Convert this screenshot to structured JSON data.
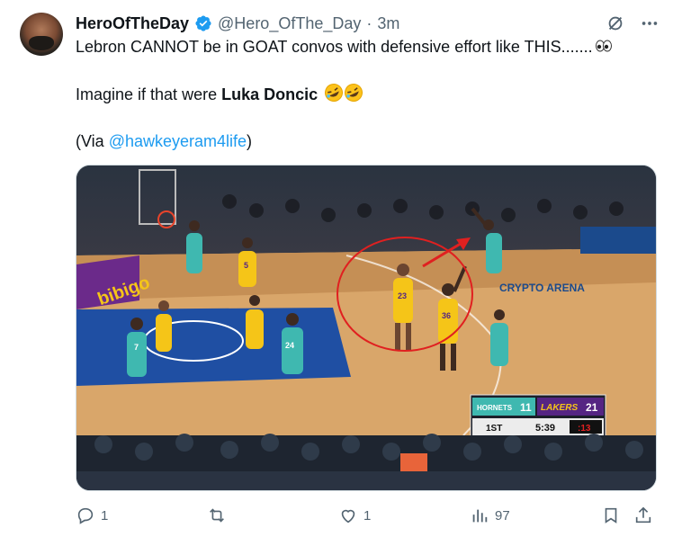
{
  "author": {
    "display_name": "HeroOfTheDay",
    "handle": "@Hero_OfThe_Day",
    "separator": "·",
    "time": "3m"
  },
  "tweet": {
    "line1": "Lebron CANNOT be in GOAT convos with defensive effort like THIS.......",
    "line2_prefix": "Imagine if that were ",
    "line2_bold": "Luka Doncic",
    "line3_prefix": "(Via ",
    "line3_mention": "@hawkeyeram4life",
    "line3_suffix": ")"
  },
  "media_texts": {
    "scoreboard_home": "HORNETS",
    "scoreboard_home_score": "11",
    "scoreboard_away": "LAKERS",
    "scoreboard_away_score": "21",
    "quarter": "1ST",
    "clock": "5:39",
    "shot_clock": ":13",
    "jersey_23": "23",
    "jersey_36": "36",
    "jersey_5": "5",
    "jersey_7": "7",
    "jersey_24": "24",
    "arena": "CRYPTO ARENA",
    "sponsor": "bibigo"
  },
  "actions": {
    "reply_count": "1",
    "like_count": "1",
    "views_count": "97"
  },
  "colors": {
    "accent": "#1d9bf0",
    "muted": "#536471",
    "lakers_gold": "#f5c518",
    "hornets_teal": "#3fb8b0"
  }
}
